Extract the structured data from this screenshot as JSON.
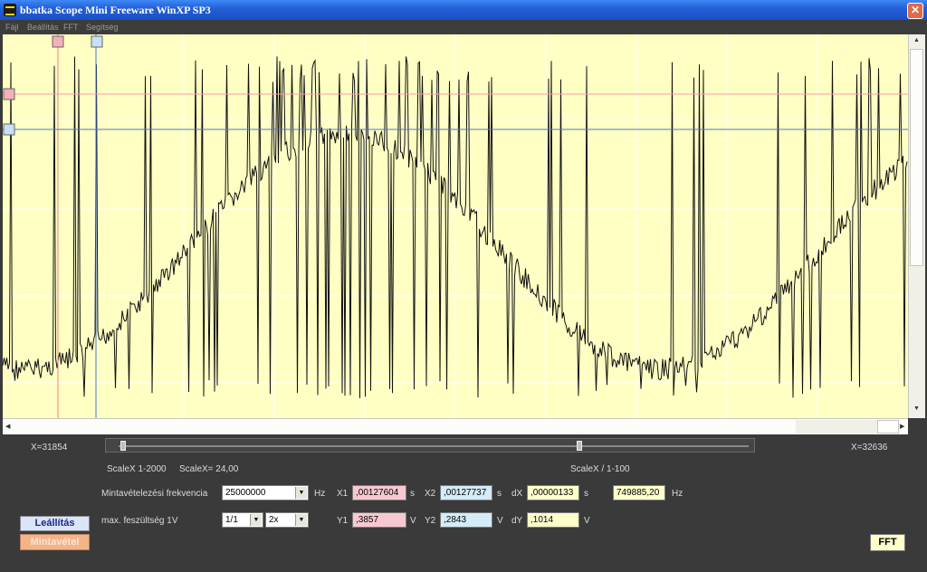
{
  "window": {
    "title": "bbatka Scope Mini Freeware WinXP SP3",
    "close_label": "✕"
  },
  "menu": {
    "items": [
      "Fájl",
      "Beállítás",
      "FFT",
      "Segítség"
    ]
  },
  "colors": {
    "scope_bg": "#ffffc4",
    "cursor_x1": "#f08080",
    "cursor_x2": "#4a7ad0",
    "signal": "#111111",
    "panel_bg": "#3a3a3a"
  },
  "panel": {
    "x_left": "X=31854",
    "x_right": "X=32636",
    "scale_range": "ScaleX 1-2000",
    "scale_value": "ScaleX= 24,00",
    "scale_div": "ScaleX / 1-100",
    "sampling_label": "Mintavételezési frekvencia",
    "sampling_value": "25000000",
    "sampling_unit": "Hz",
    "maxvolt_label": "max. feszültség  1V",
    "div_value": "1/1",
    "mult_value": "2x",
    "x1_label": "X1",
    "x1_value": ",00127604",
    "x1_unit": "s",
    "x2_label": "X2",
    "x2_value": ",00127737",
    "x2_unit": "s",
    "dx_label": "dX",
    "dx_value": ",00000133",
    "dx_unit": "s",
    "freq_value": "749885,20",
    "freq_unit": "Hz",
    "y1_label": "Y1",
    "y1_value": ",3857",
    "y1_unit": "V",
    "y2_label": "Y2",
    "y2_value": ",2843",
    "y2_unit": "V",
    "dy_label": "dY",
    "dy_value": ",1014",
    "dy_unit": "V",
    "stop_button": "Leállítás",
    "sample_button": "Mintavétel",
    "fft_button": "FFT"
  }
}
